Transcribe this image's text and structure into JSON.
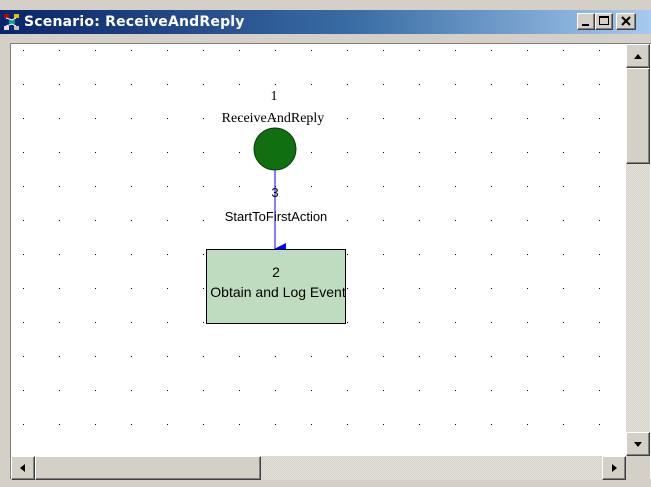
{
  "window": {
    "title": "Scenario: ReceiveAndReply",
    "icon": "scenario-icon",
    "buttons": [
      "minimize-icon",
      "maximize-icon",
      "close-icon"
    ]
  },
  "diagram": {
    "start_node": {
      "number": "1",
      "label": "ReceiveAndReply",
      "color": "#107010"
    },
    "transition": {
      "number": "3",
      "label": "StartToFirstAction",
      "color": "#0000ff"
    },
    "action_node": {
      "number": "2",
      "label": "Obtain and Log Event",
      "fill": "#c0dcc0"
    },
    "grid_dot_color": "#000000"
  },
  "scrollbars": {
    "vertical": {
      "up_icon": "arrow-up-icon",
      "down_icon": "arrow-down-icon"
    },
    "horizontal": {
      "left_icon": "arrow-left-icon",
      "right_icon": "arrow-right-icon"
    }
  }
}
